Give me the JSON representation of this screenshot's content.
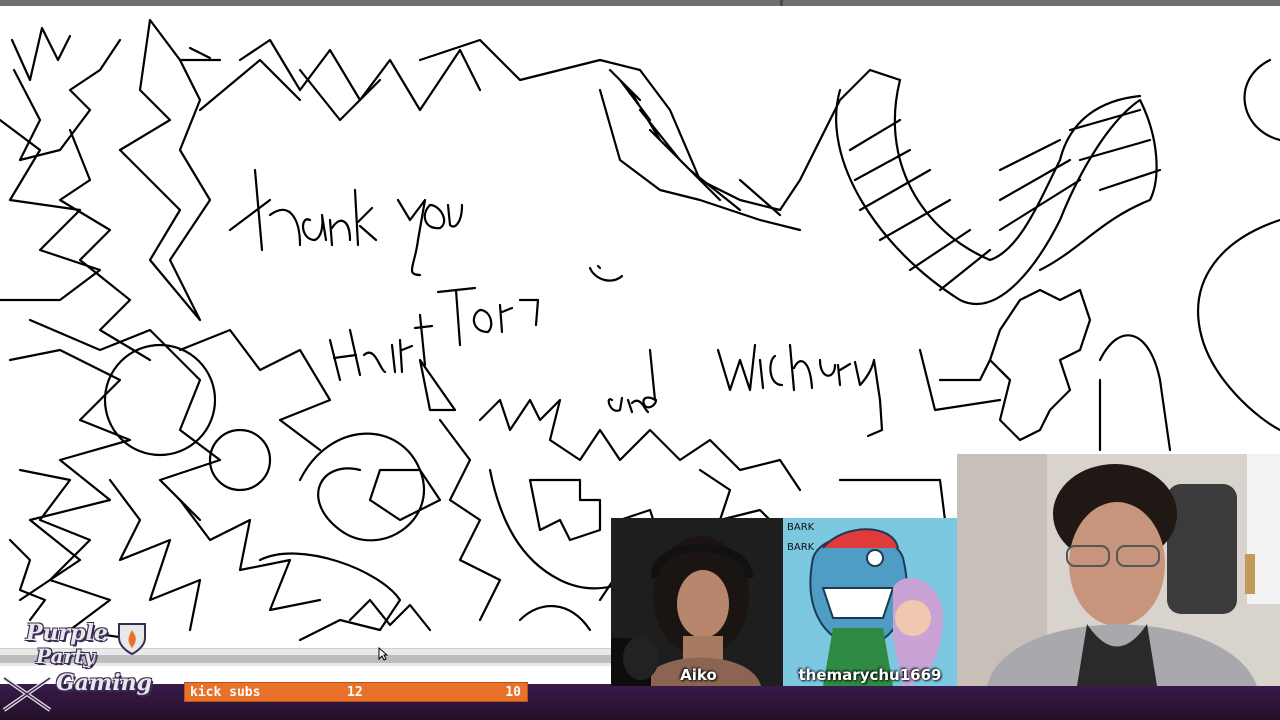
{
  "stream": {
    "logo": {
      "line1": "Purple",
      "line2": "Party",
      "line3": "Gaming"
    },
    "sub_goal": {
      "label": "kick subs",
      "current": "12",
      "goal": "10"
    },
    "cams": [
      {
        "name": "Aiko"
      },
      {
        "name": "themarychu1669"
      },
      {
        "name": ""
      }
    ]
  },
  "colors": {
    "sub_bar": "#e8722a",
    "bottom_bar": "#2f1540",
    "logo_outline": "#3b2b57"
  },
  "icons": [
    "shield-flame-icon",
    "crossed-swords-icon",
    "mouse-pointer-icon"
  ]
}
